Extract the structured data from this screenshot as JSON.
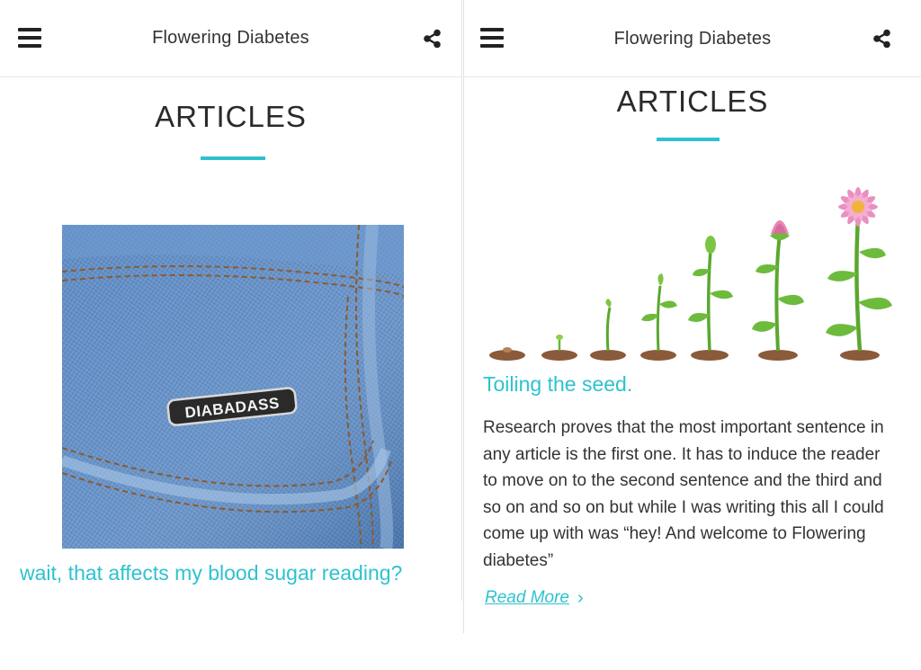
{
  "colors": {
    "accent": "#2ec2cf",
    "text": "#2b2b2b",
    "denim": "#5a86c0"
  },
  "screens": [
    {
      "header": {
        "title": "Flowering Diabetes",
        "menu_icon": "hamburger-menu-icon",
        "share_icon": "share-icon"
      },
      "section_title": "ARTICLES",
      "article": {
        "image_alt": "Denim jacket pocket with DIABADASS enamel pin",
        "pin_text": "DIABADASS",
        "title": "wait, that affects my blood sugar reading?"
      }
    },
    {
      "header": {
        "title": "Flowering Diabetes",
        "menu_icon": "hamburger-menu-icon",
        "share_icon": "share-icon"
      },
      "section_title": "ARTICLES",
      "article": {
        "image_alt": "Stages of a seed growing into a flower",
        "title": "Toiling the seed.",
        "excerpt": "Research proves that the most important sentence in any article is the first one. It has to induce the reader to move on to the second sentence and the third and so on and so on but while I was writing this all I could come up with was “hey! And welcome to Flowering diabetes”",
        "read_more": "Read More",
        "read_more_icon": "chevron-right-icon"
      }
    }
  ]
}
